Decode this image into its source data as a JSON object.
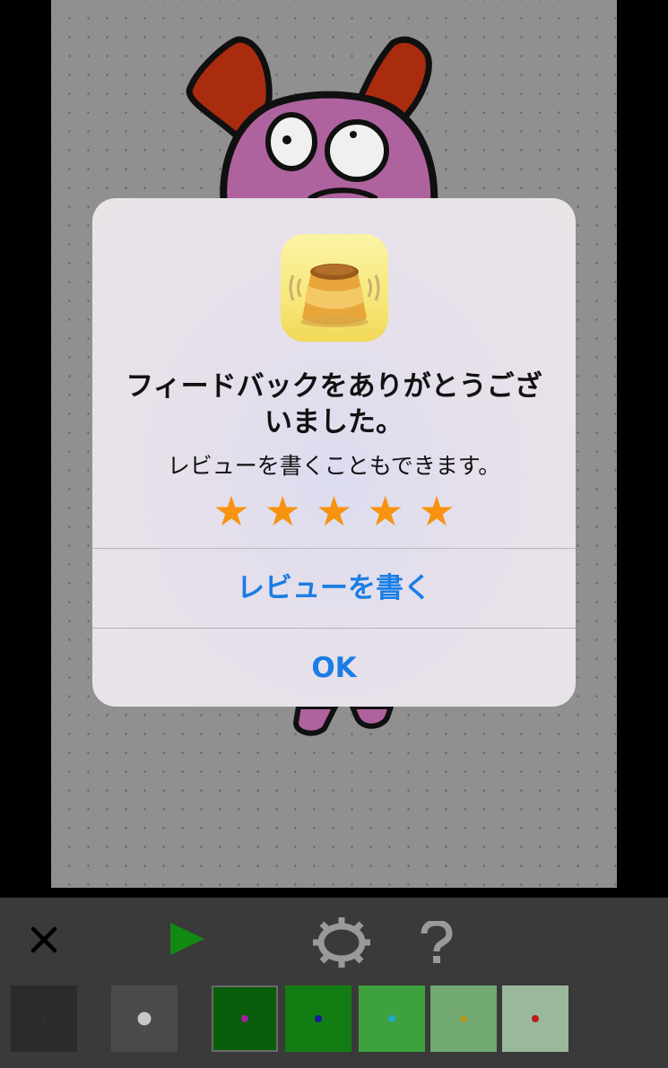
{
  "dialog": {
    "title": "フィードバックをありがとうございました。",
    "message": "レビューを書くこともできます。",
    "rating": {
      "value": 5,
      "max": 5,
      "star_color": "#f7930f"
    },
    "write_review_label": "レビューを書く",
    "ok_label": "OK",
    "button_color": "#1b7de4",
    "app_icon": "pudding-app-icon"
  },
  "toolbar": {
    "close_icon": "close-icon",
    "play_icon": "play-icon",
    "settings_icon": "gear-icon",
    "help_icon": "help-icon",
    "brush_sizes": [
      {
        "name": "brush-size-small",
        "color": "#2b2b2b"
      },
      {
        "name": "brush-size-large",
        "color": "#4a4a4a"
      }
    ],
    "swatches": [
      {
        "color": "#0a5d0a",
        "dot": "#a020a0",
        "selected": true
      },
      {
        "color": "#127d12",
        "dot": "#1a1a9a",
        "selected": false
      },
      {
        "color": "#3da23d",
        "dot": "#20a8c8",
        "selected": false
      },
      {
        "color": "#72a872",
        "dot": "#b09a20",
        "selected": false
      },
      {
        "color": "#9ab89a",
        "dot": "#c01818",
        "selected": false
      }
    ]
  }
}
